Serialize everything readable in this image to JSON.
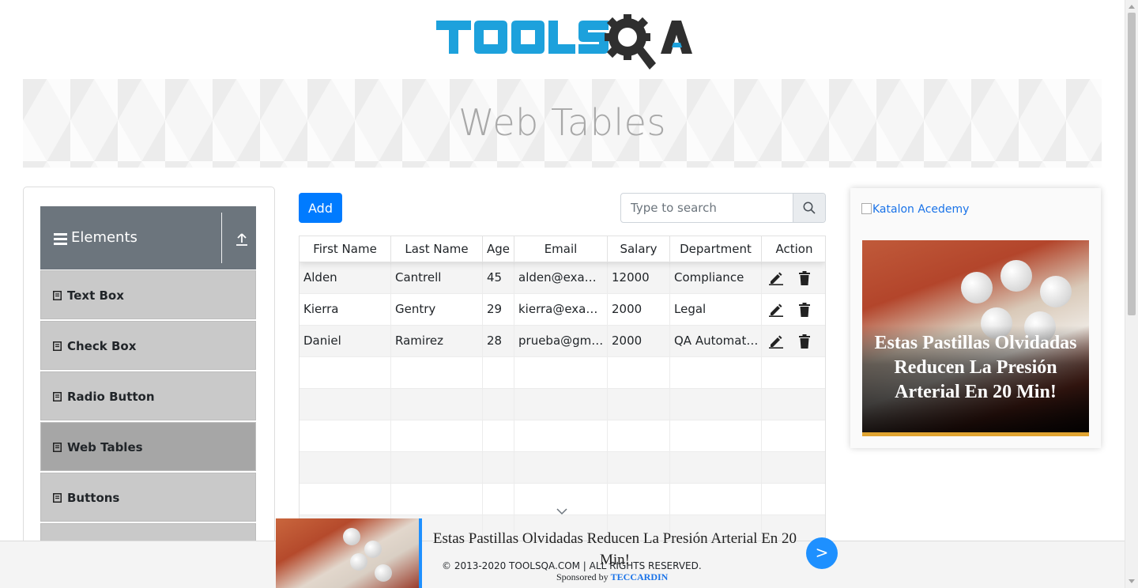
{
  "logo": {
    "text": "TOOLSQA",
    "brand_blue": "#1da1dc",
    "brand_dark": "#2f2f2f"
  },
  "banner": {
    "title": "Web Tables"
  },
  "sidebar": {
    "group_title": "Elements",
    "items": [
      {
        "label": "Text Box",
        "active": false
      },
      {
        "label": "Check Box",
        "active": false
      },
      {
        "label": "Radio Button",
        "active": false
      },
      {
        "label": "Web Tables",
        "active": true
      },
      {
        "label": "Buttons",
        "active": false
      }
    ]
  },
  "toolbar": {
    "add_label": "Add",
    "search_placeholder": "Type to search"
  },
  "table": {
    "columns": [
      "First Name",
      "Last Name",
      "Age",
      "Email",
      "Salary",
      "Department",
      "Action"
    ],
    "rows": [
      [
        "Alden",
        "Cantrell",
        "45",
        "alden@example.com",
        "12000",
        "Compliance"
      ],
      [
        "Kierra",
        "Gentry",
        "29",
        "kierra@example.com",
        "2000",
        "Legal"
      ],
      [
        "Daniel",
        "Ramirez",
        "28",
        "prueba@gmail.com",
        "2000",
        "QA Automation"
      ]
    ]
  },
  "right_ad": {
    "alt_text": "Katalon Acedemy",
    "headline": "Estas Pastillas Olvidadas Reducen La Presión Arterial En 20 Min!"
  },
  "sticky_ad": {
    "text": "Estas Pastillas Olvidadas Reducen La Presión Arterial En 20 Min!",
    "button": ">"
  },
  "footer": {
    "copyright": "© 2013-2020 TOOLSQA.COM | ALL RIGHTS RESERVED.",
    "sponsored_prefix": "Sponsored by ",
    "sponsored_by": "TECCARDIN"
  },
  "colors": {
    "primary": "#007bff",
    "sidebar_header": "#6c757d",
    "menu_item": "#c9c9c9",
    "menu_item_active": "#a6a6a6"
  }
}
